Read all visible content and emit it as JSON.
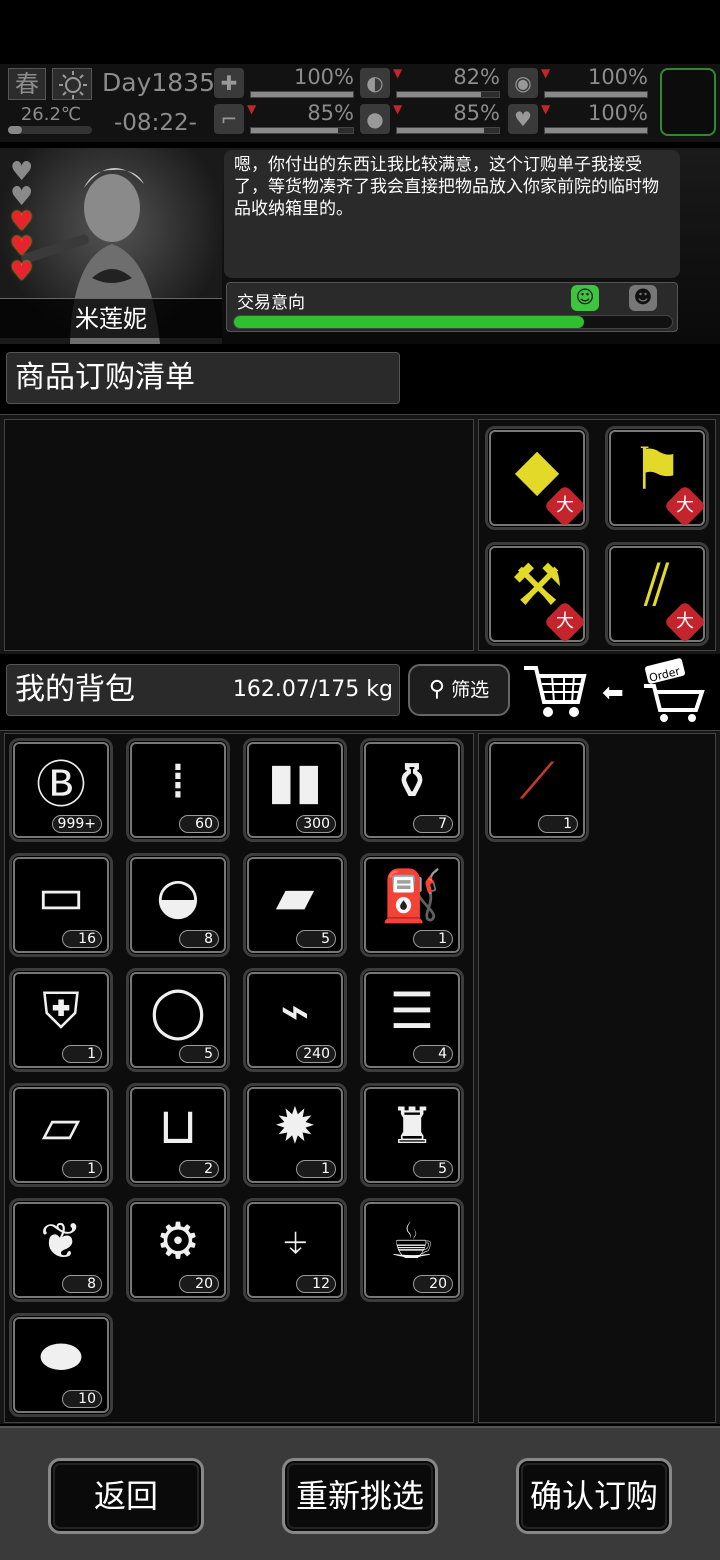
{
  "status": {
    "season": "春",
    "weather_icon": "sun-icon",
    "temperature": "26.2℃",
    "day": "Day1835",
    "time": "-08:22-",
    "stats": [
      {
        "name": "health",
        "icon": "medkit-icon",
        "value": "100%",
        "level": 1.0,
        "down": false
      },
      {
        "name": "hunger",
        "icon": "stomach-icon",
        "value": "82%",
        "level": 0.82,
        "down": true
      },
      {
        "name": "pills",
        "icon": "pill-icon",
        "value": "100%",
        "level": 1.0,
        "down": true
      },
      {
        "name": "stamina",
        "icon": "boot-icon",
        "value": "85%",
        "level": 0.85,
        "down": true
      },
      {
        "name": "thirst",
        "icon": "water-drop-icon",
        "value": "85%",
        "level": 0.85,
        "down": true
      },
      {
        "name": "mood",
        "icon": "heart-icon",
        "value": "100%",
        "level": 1.0,
        "down": true
      }
    ]
  },
  "npc": {
    "name": "米莲妮",
    "hearts_filled": 3,
    "hearts_total": 5,
    "dialog": "嗯，你付出的东西让我比较满意，这个订购单子我接受了，等货物凑齐了我会直接把物品放入你家前院的临时物品收纳箱里的。",
    "trade_label": "交易意向",
    "trade_level": 0.8,
    "colors": {
      "happy": "#3ec43e",
      "bar": "#2ec02e"
    }
  },
  "order": {
    "title": "商品订购清单",
    "categories": [
      {
        "icon": "board-icon",
        "badge": "大"
      },
      {
        "icon": "cloth-icon",
        "badge": "大"
      },
      {
        "icon": "scrap-parts-icon",
        "badge": "大"
      },
      {
        "icon": "wood-planks-icon",
        "badge": "大"
      }
    ]
  },
  "backpack": {
    "title": "我的背包",
    "weight": "162.07/175 kg",
    "filter_label": "筛选",
    "items": [
      {
        "icon": "coin-icon",
        "count": "999+"
      },
      {
        "icon": "bullets-icon",
        "count": "60"
      },
      {
        "icon": "ammo-clips-icon",
        "count": "300"
      },
      {
        "icon": "bottles-icon",
        "count": "7"
      },
      {
        "icon": "bread-icon",
        "count": "16"
      },
      {
        "icon": "canned-food-icon",
        "count": "8"
      },
      {
        "icon": "gold-bars-icon",
        "count": "5"
      },
      {
        "icon": "scuba-tank-icon",
        "count": "1"
      },
      {
        "icon": "body-armor-icon",
        "count": "1"
      },
      {
        "icon": "ring-icon",
        "count": "5"
      },
      {
        "icon": "glue-icon",
        "count": "240"
      },
      {
        "icon": "towels-icon",
        "count": "4"
      },
      {
        "icon": "paper-icon",
        "count": "1"
      },
      {
        "icon": "beaker-icon",
        "count": "2"
      },
      {
        "icon": "grenade-icon",
        "count": "1"
      },
      {
        "icon": "ice-bucket-icon",
        "count": "5"
      },
      {
        "icon": "corn-icon",
        "count": "8"
      },
      {
        "icon": "pickle-jar-icon",
        "count": "20"
      },
      {
        "icon": "water-bottle-icon",
        "count": "12"
      },
      {
        "icon": "coffee-cup-icon",
        "count": "20"
      },
      {
        "icon": "meat-icon",
        "count": "10"
      }
    ],
    "side_items": [
      {
        "icon": "rocket-launcher-icon",
        "count": "1"
      }
    ]
  },
  "footer": {
    "back": "返回",
    "reselect": "重新挑选",
    "confirm": "确认订购"
  }
}
